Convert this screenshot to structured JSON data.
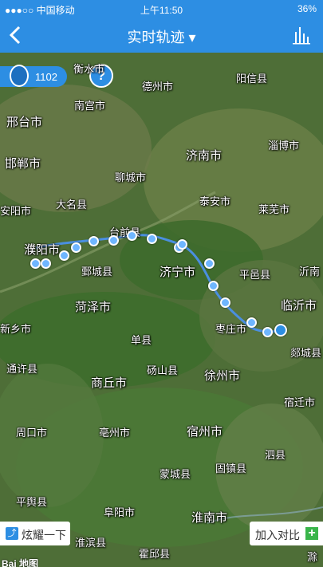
{
  "status_bar": {
    "carrier": "●●●○○ 中国移动",
    "time": "上午11:50",
    "battery": "36%"
  },
  "header": {
    "title": "实时轨迹 ▾"
  },
  "map": {
    "vehicle_count": "1102",
    "help_symbol": "?",
    "cities": [
      {
        "name": "衡水市",
        "big": false
      },
      {
        "name": "德州市",
        "big": false
      },
      {
        "name": "南宫市",
        "big": false
      },
      {
        "name": "阳信县",
        "big": false
      },
      {
        "name": "邢台市",
        "big": true
      },
      {
        "name": "济南市",
        "big": true
      },
      {
        "name": "淄博市",
        "big": false
      },
      {
        "name": "邯郸市",
        "big": true
      },
      {
        "name": "聊城市",
        "big": false
      },
      {
        "name": "泰安市",
        "big": false
      },
      {
        "name": "大名县",
        "big": false
      },
      {
        "name": "莱芜市",
        "big": false
      },
      {
        "name": "安阳市",
        "big": false
      },
      {
        "name": "台前县",
        "big": false
      },
      {
        "name": "濮阳市",
        "big": true
      },
      {
        "name": "鄄城县",
        "big": false
      },
      {
        "name": "济宁市",
        "big": true
      },
      {
        "name": "平邑县",
        "big": false
      },
      {
        "name": "沂南",
        "big": false
      },
      {
        "name": "菏泽市",
        "big": true
      },
      {
        "name": "临沂市",
        "big": true
      },
      {
        "name": "新乡市",
        "big": false
      },
      {
        "name": "枣庄市",
        "big": false
      },
      {
        "name": "单县",
        "big": false
      },
      {
        "name": "郯城县",
        "big": false
      },
      {
        "name": "通许县",
        "big": false
      },
      {
        "name": "砀山县",
        "big": false
      },
      {
        "name": "徐州市",
        "big": true
      },
      {
        "name": "商丘市",
        "big": true
      },
      {
        "name": "宿迁市",
        "big": false
      },
      {
        "name": "周口市",
        "big": false
      },
      {
        "name": "亳州市",
        "big": false
      },
      {
        "name": "宿州市",
        "big": true
      },
      {
        "name": "泗县",
        "big": false
      },
      {
        "name": "蒙城县",
        "big": false
      },
      {
        "name": "固镇县",
        "big": false
      },
      {
        "name": "平舆县",
        "big": false
      },
      {
        "name": "阜阳市",
        "big": false
      },
      {
        "name": "淮南市",
        "big": true
      },
      {
        "name": "淮滨县",
        "big": false
      },
      {
        "name": "霍邱县",
        "big": false
      },
      {
        "name": "滁",
        "big": false
      }
    ],
    "share_label": "炫耀一下",
    "compare_label": "加入对比",
    "logo_text": "Bai 地图"
  }
}
